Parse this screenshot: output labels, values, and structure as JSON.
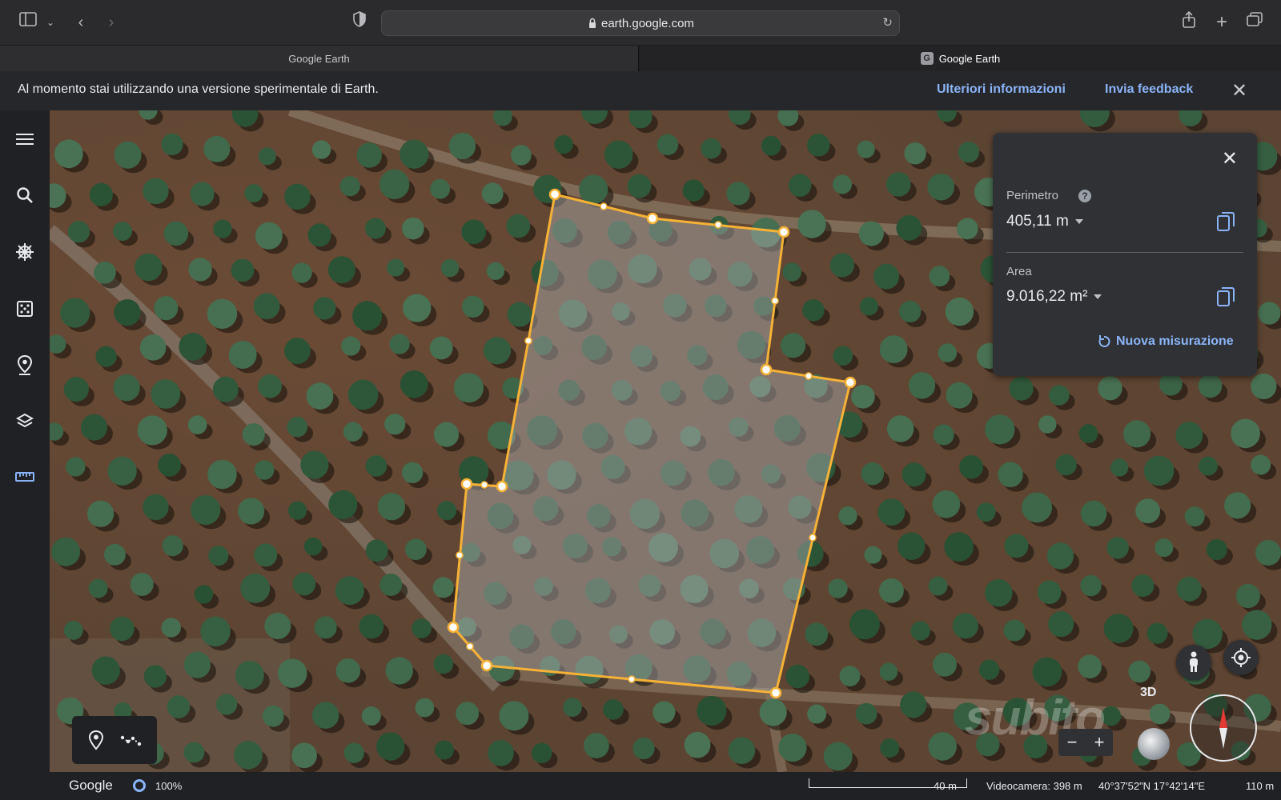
{
  "browser": {
    "url": "earth.google.com",
    "tabs": [
      {
        "label": "Google Earth",
        "favicon": "earth-globe-icon"
      },
      {
        "label": "Google Earth",
        "favicon": "g-letter-icon"
      }
    ]
  },
  "banner": {
    "message": "Al momento stai utilizzando una versione sperimentale di Earth.",
    "more_info": "Ulteriori informazioni",
    "feedback": "Invia feedback"
  },
  "rail": {
    "items": [
      {
        "icon": "menu-icon"
      },
      {
        "icon": "search-icon"
      },
      {
        "icon": "voyager-icon"
      },
      {
        "icon": "feeling-lucky-icon"
      },
      {
        "icon": "projects-icon"
      },
      {
        "icon": "map-style-icon"
      },
      {
        "icon": "ruler-icon",
        "active": true
      }
    ]
  },
  "measure": {
    "perimeter_label": "Perimetro",
    "perimeter_value": "405,11 m",
    "area_label": "Area",
    "area_value": "9.016,22 m²",
    "new_measure": "Nuova misurazione"
  },
  "controls": {
    "badge_3d": "3D"
  },
  "watermark": "subito",
  "status": {
    "google": "Google",
    "load_percent": "100%",
    "scale_label": "40 m",
    "camera": "Videocamera: 398 m",
    "coords": "40°37'52\"N 17°42'14\"E",
    "altitude": "110 m"
  },
  "colors": {
    "accent_link": "#8ab4f8",
    "measure_line": "#f6b236",
    "panel_bg": "#303134"
  }
}
